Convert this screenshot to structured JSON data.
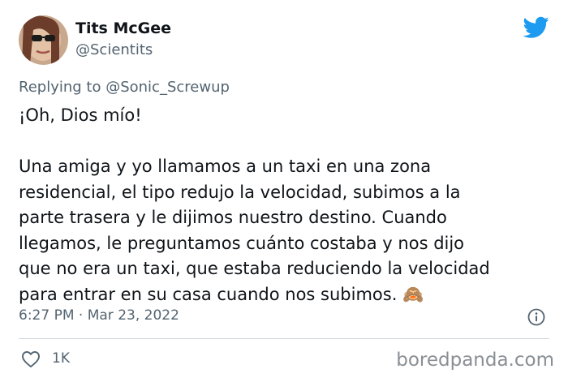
{
  "author": {
    "display_name": "Tits McGee",
    "handle": "@Scientits"
  },
  "replying_to": "Replying to @Sonic_Screwup",
  "tweet": {
    "text": "¡Oh, Dios mío!\n\nUna amiga y yo llamamos a un taxi en una zona\nresidencial, el tipo redujo la velocidad, subimos a la\nparte trasera y le dijimos nuestro destino. Cuando\nllegamos, le preguntamos cuánto costaba y nos dijo\nque no era un taxi, que estaba reduciendo la velocidad\npara entrar en su casa cuando nos subimos. 🙈",
    "timestamp": "6:27 PM · Mar 23, 2022"
  },
  "engagement": {
    "likes": "1K"
  },
  "watermark": "boredpanda.com",
  "icons": {
    "brand": "twitter-bird-icon",
    "info": "info-icon",
    "like": "heart-icon"
  },
  "colors": {
    "brand_blue": "#1d9bf0",
    "text_primary": "#0f1419",
    "text_secondary": "#536471",
    "divider": "#cfd9de",
    "watermark": "#8a8f94"
  }
}
